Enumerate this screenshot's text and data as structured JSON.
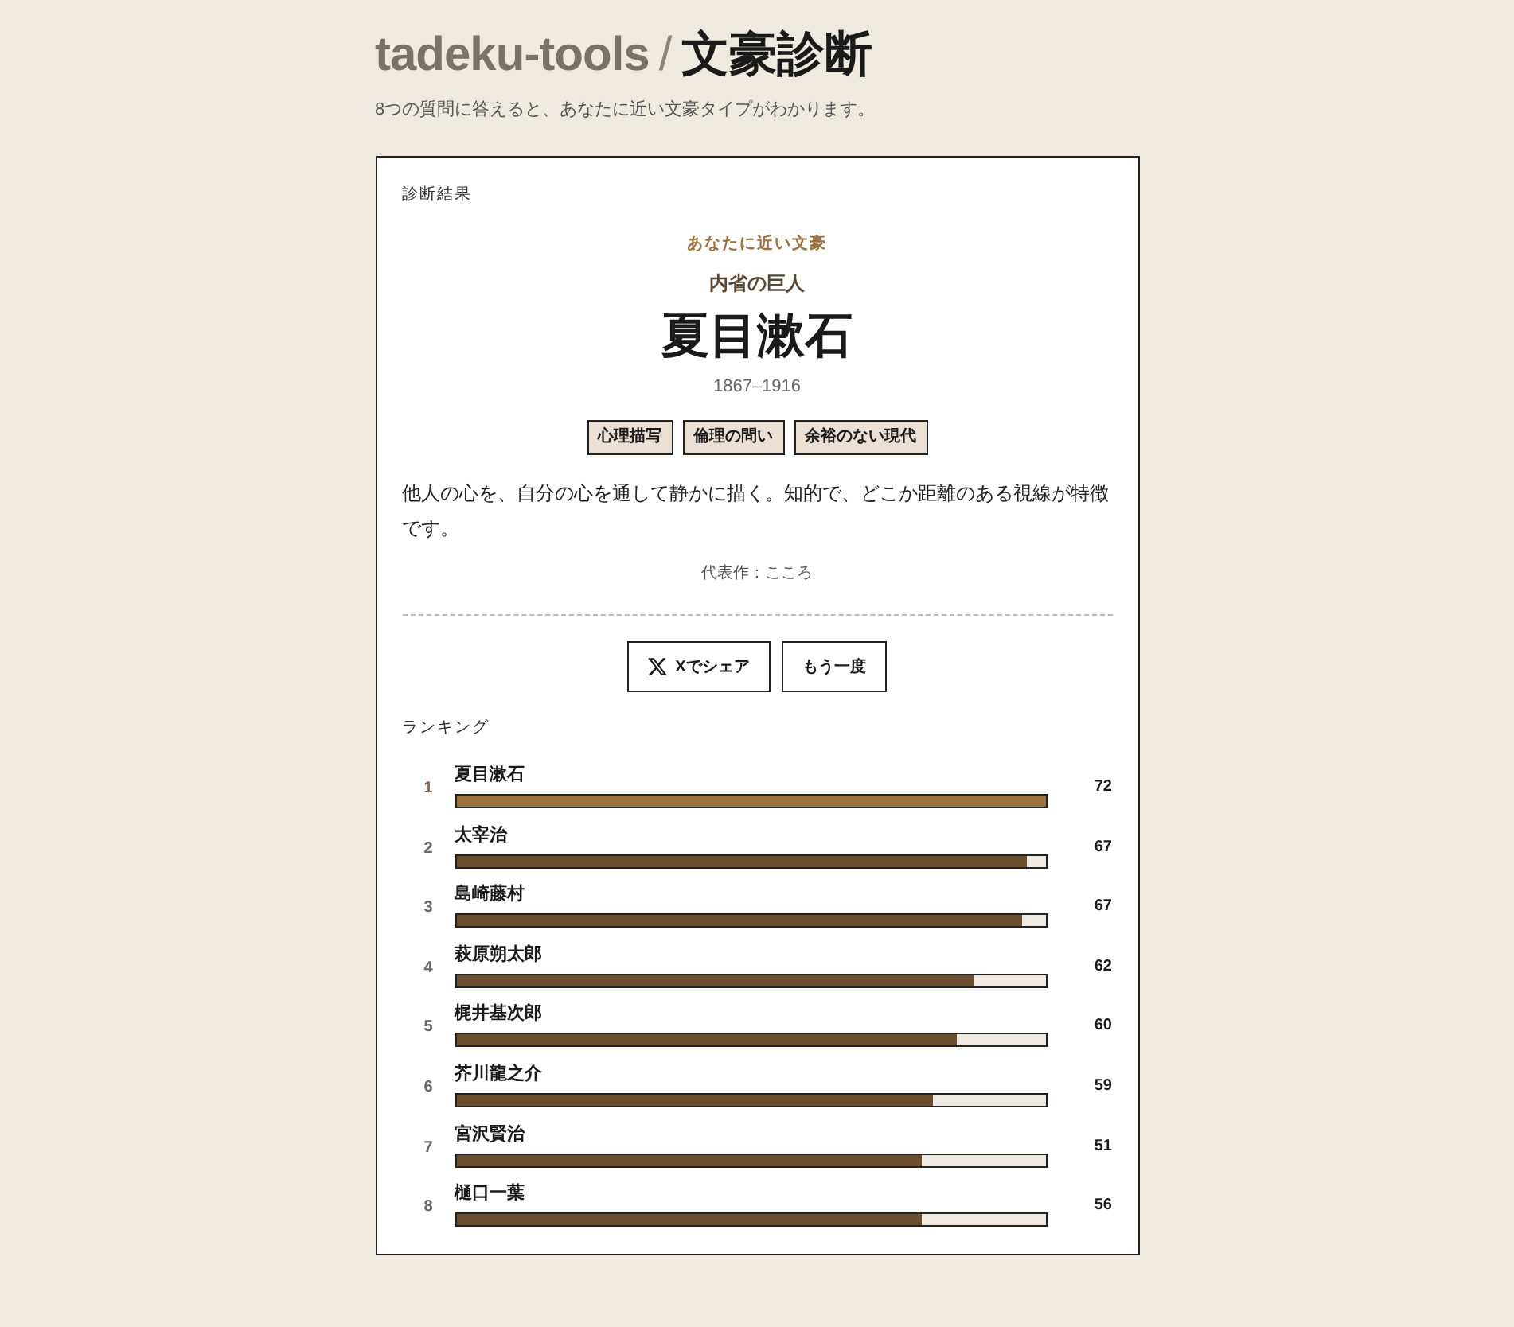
{
  "header": {
    "site_name": "tadeku-tools",
    "separator": "/",
    "title": "文豪診断",
    "subtitle": "8つの質問に答えると、あなたに近い文豪タイプがわかります。"
  },
  "result": {
    "heading": "診断結果",
    "eyebrow": "あなたに近い文豪",
    "type_name": "内省の巨人",
    "author": "夏目漱石",
    "years": "1867–1916",
    "tags": [
      "心理描写",
      "倫理の問い",
      "余裕のない現代"
    ],
    "description": "他人の心を、自分の心を通して静かに描く。知的で、どこか距離のある視線が特徴です。",
    "representative_work": "代表作：こころ"
  },
  "actions": [
    {
      "kind": "share",
      "label": "Xでシェア"
    },
    {
      "kind": "retry",
      "label": "もう一度"
    }
  ],
  "ranking": {
    "heading": "ランキング",
    "items": [
      {
        "rank": "1",
        "name": "夏目漱石",
        "score": "72",
        "level": 1,
        "highlighted": true
      },
      {
        "rank": "2",
        "name": "太宰治",
        "score": "67",
        "level": 0.97,
        "highlighted": false
      },
      {
        "rank": "3",
        "name": "島崎藤村",
        "score": "67",
        "level": 0.96,
        "highlighted": false
      },
      {
        "rank": "4",
        "name": "萩原朔太郎",
        "score": "62",
        "level": 0.88,
        "highlighted": false
      },
      {
        "rank": "5",
        "name": "梶井基次郎",
        "score": "60",
        "level": 0.85,
        "highlighted": false
      },
      {
        "rank": "6",
        "name": "芥川龍之介",
        "score": "59",
        "level": 0.81,
        "highlighted": false
      },
      {
        "rank": "7",
        "name": "宮沢賢治",
        "score": "51",
        "level": 0.79,
        "highlighted": false
      },
      {
        "rank": "8",
        "name": "樋口一葉",
        "score": "56",
        "level": 0.79,
        "highlighted": false
      }
    ]
  }
}
